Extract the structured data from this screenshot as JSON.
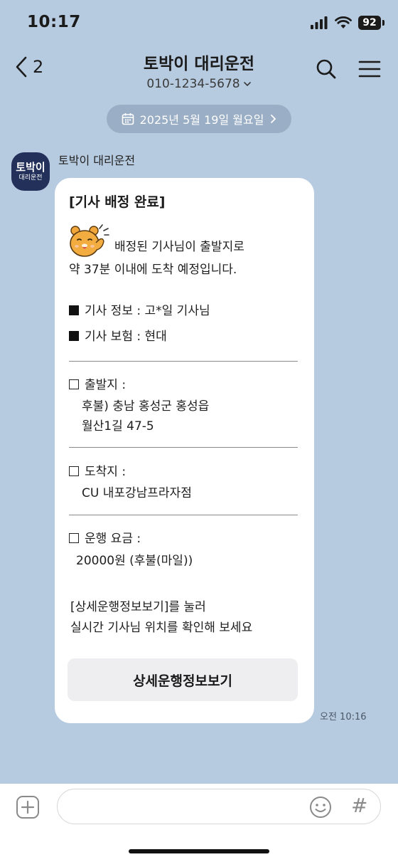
{
  "status_bar": {
    "time": "10:17",
    "battery": "92",
    "icons": [
      "signal-icon",
      "wifi-icon",
      "battery-icon"
    ]
  },
  "header": {
    "back_count": "2",
    "title": "토박이 대리운전",
    "subtitle": "010-1234-5678",
    "icons": [
      "chevron-left-icon",
      "chevron-down-icon",
      "search-icon",
      "menu-icon"
    ]
  },
  "date_pill": {
    "label": "2025년 5월 19일 월요일",
    "icons": [
      "calendar-icon",
      "chevron-right-icon"
    ]
  },
  "sender": {
    "name": "토박이 대리운전",
    "avatar_line1": "토박이",
    "avatar_line2": "대리운전"
  },
  "message": {
    "heading": "[기사 배정 완료]",
    "intro_line1": "배정된 기사님이 출발지로",
    "intro_line2": "약 37분 이내에 도착 예정입니다.",
    "driver_info": "기사 정보 : 고*일 기사님",
    "driver_insurance": "기사 보험 : 현대",
    "origin_label": "출발지 :",
    "origin_line1": "후불) 충남 홍성군 홍성읍",
    "origin_line2": "월산1길 47-5",
    "destination_label": "도착지 :",
    "destination_value": "CU 내포강남프라자점",
    "fare_label": "운행 요금 :",
    "fare_value": "20000원 (후불(마일))",
    "guide_line1": "[상세운행정보보기]를 눌러",
    "guide_line2": "실시간 기사님 위치를 확인해 보세요",
    "button_label": "상세운행정보보기",
    "time": "오전 10:16"
  },
  "input_bar": {
    "placeholder": "",
    "hash": "#",
    "icons": [
      "plus-icon",
      "emoji-icon",
      "hash-icon"
    ]
  },
  "colors": {
    "chat_background": "#b7cbe0",
    "bubble": "#ffffff",
    "avatar": "#22305a",
    "button": "#eeeef1"
  }
}
